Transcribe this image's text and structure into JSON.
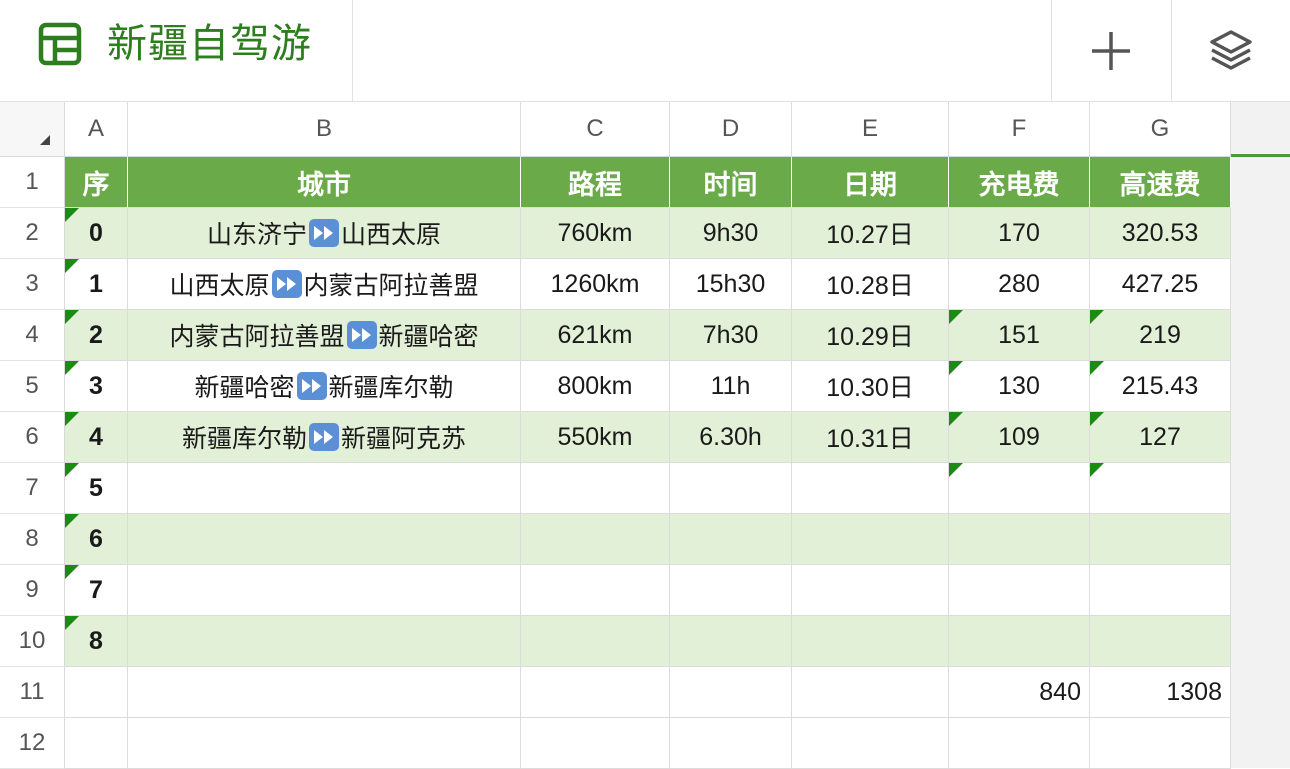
{
  "app": {
    "title": "新疆自驾游",
    "icons": {
      "sheet": "spreadsheet-icon",
      "add": "plus-icon",
      "layers": "layers-icon"
    },
    "accent": "#2e7d1f"
  },
  "grid": {
    "column_headers": [
      "A",
      "B",
      "C",
      "D",
      "E",
      "F",
      "G"
    ],
    "row_headers": [
      "1",
      "2",
      "3",
      "4",
      "5",
      "6",
      "7",
      "8",
      "9",
      "10",
      "11",
      "12"
    ],
    "table_headers": [
      "序",
      "城市",
      "路程",
      "时间",
      "日期",
      "充电费",
      "高速费"
    ],
    "header_color": "#6aaa48",
    "band_color": "#e3f0d8",
    "rows": [
      {
        "seq": "0",
        "from": "山东济宁",
        "to": "山西太原",
        "distance": "760km",
        "time": "9h30",
        "date": "10.27日",
        "charge": "170",
        "toll": "320.53"
      },
      {
        "seq": "1",
        "from": "山西太原",
        "to": "内蒙古阿拉善盟",
        "distance": "1260km",
        "time": "15h30",
        "date": "10.28日",
        "charge": "280",
        "toll": "427.25"
      },
      {
        "seq": "2",
        "from": "内蒙古阿拉善盟",
        "to": "新疆哈密",
        "distance": "621km",
        "time": "7h30",
        "date": "10.29日",
        "charge": "151",
        "toll": "219"
      },
      {
        "seq": "3",
        "from": "新疆哈密",
        "to": "新疆库尔勒",
        "distance": "800km",
        "time": "11h",
        "date": "10.30日",
        "charge": "130",
        "toll": "215.43"
      },
      {
        "seq": "4",
        "from": "新疆库尔勒",
        "to": "新疆阿克苏",
        "distance": "550km",
        "time": "6.30h",
        "date": "10.31日",
        "charge": "109",
        "toll": "127"
      },
      {
        "seq": "5"
      },
      {
        "seq": "6"
      },
      {
        "seq": "7"
      },
      {
        "seq": "8"
      }
    ],
    "totals": {
      "charge": "840",
      "toll": "1308"
    }
  }
}
